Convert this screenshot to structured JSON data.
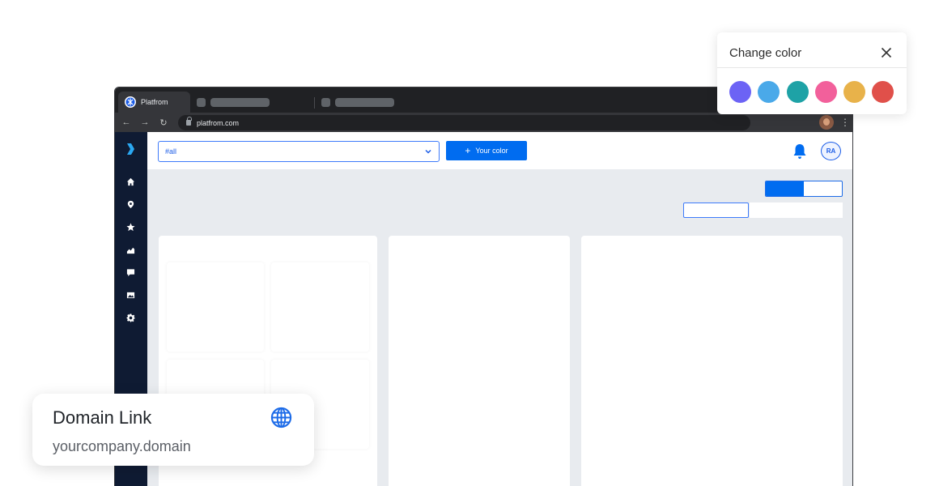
{
  "browser": {
    "active_tab_title": "Platfrom",
    "url": "platfrom.com"
  },
  "app": {
    "filter_value": "#all",
    "primary_button_label": "Your color",
    "avatar_initials": "RA",
    "accent_color": "#006cf0",
    "sidebar_icons": [
      "home-icon",
      "location-pin-icon",
      "star-icon",
      "chart-icon",
      "chat-icon",
      "image-icon",
      "settings-icon"
    ]
  },
  "color_panel": {
    "title": "Change color",
    "swatches": [
      "#6c63f5",
      "#4aa9e9",
      "#1ea2a6",
      "#f2609b",
      "#e8b24a",
      "#e0504a"
    ]
  },
  "domain_card": {
    "title": "Domain Link",
    "subtitle": "yourcompany.domain"
  }
}
